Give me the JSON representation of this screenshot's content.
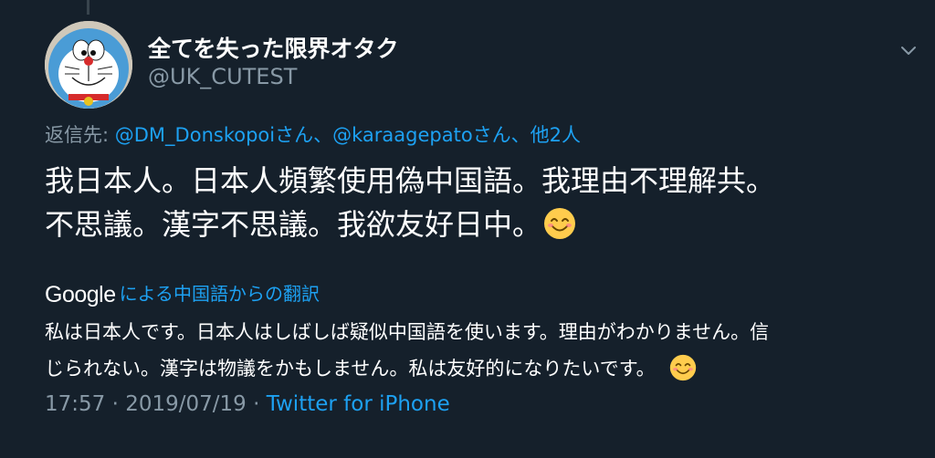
{
  "user": {
    "display_name": "全てを失った限界オタク",
    "handle": "@UK_CUTEST"
  },
  "reply": {
    "prefix": "返信先: ",
    "mention_1": "@DM_Donskopoi",
    "suffix_1": "さん、",
    "mention_2": "@karaagepato",
    "suffix_2": "さん、",
    "others": "他2人"
  },
  "tweet": {
    "line_1": "我日本人。日本人頻繁使用偽中国語。我理由不理解共。",
    "line_2": "不思議。漢字不思議。我欲友好日中。"
  },
  "translation": {
    "provider": "Google",
    "link_label": "による中国語からの翻訳",
    "line_1": "私は日本人です。日本人はしばしば疑似中国語を使います。理由がわかりません。信",
    "line_2": "じられない。漢字は物議をかもしません。私は友好的になりたいです。"
  },
  "meta": {
    "time": "17:57",
    "date": "2019/07/19",
    "separator": " · ",
    "source": "Twitter for iPhone"
  },
  "icons": {
    "avatar": "doraemon-avatar",
    "menu": "chevron-down-icon",
    "emoji": "smiling-face-emoji"
  },
  "colors": {
    "background": "#15202b",
    "link": "#1da1f2",
    "secondary_text": "#8899a6"
  }
}
